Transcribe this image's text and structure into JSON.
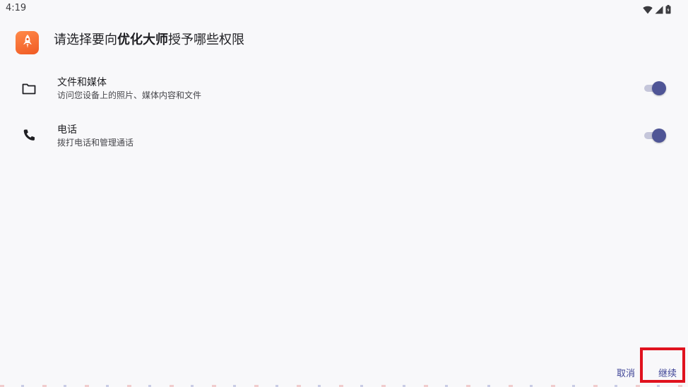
{
  "status_bar": {
    "time": "4:19",
    "icons": [
      "wifi-icon",
      "signal-icon",
      "battery-icon"
    ]
  },
  "header": {
    "title_before": "请选择要向",
    "app_name": "优化大师",
    "title_after": "授予哪些权限",
    "app_icon": "rocket-icon",
    "app_icon_color": "#f26b32"
  },
  "permissions": [
    {
      "icon": "folder-icon",
      "title": "文件和媒体",
      "description": "访问您设备上的照片、媒体内容和文件",
      "enabled": true
    },
    {
      "icon": "phone-icon",
      "title": "电话",
      "description": "拨打电话和管理通话",
      "enabled": true
    }
  ],
  "buttons": {
    "cancel": "取消",
    "continue": "继续"
  },
  "colors": {
    "accent": "#4f5596",
    "toggle_track": "#c5c6da",
    "button_text": "#3f4597",
    "highlight": "#e0121e"
  }
}
